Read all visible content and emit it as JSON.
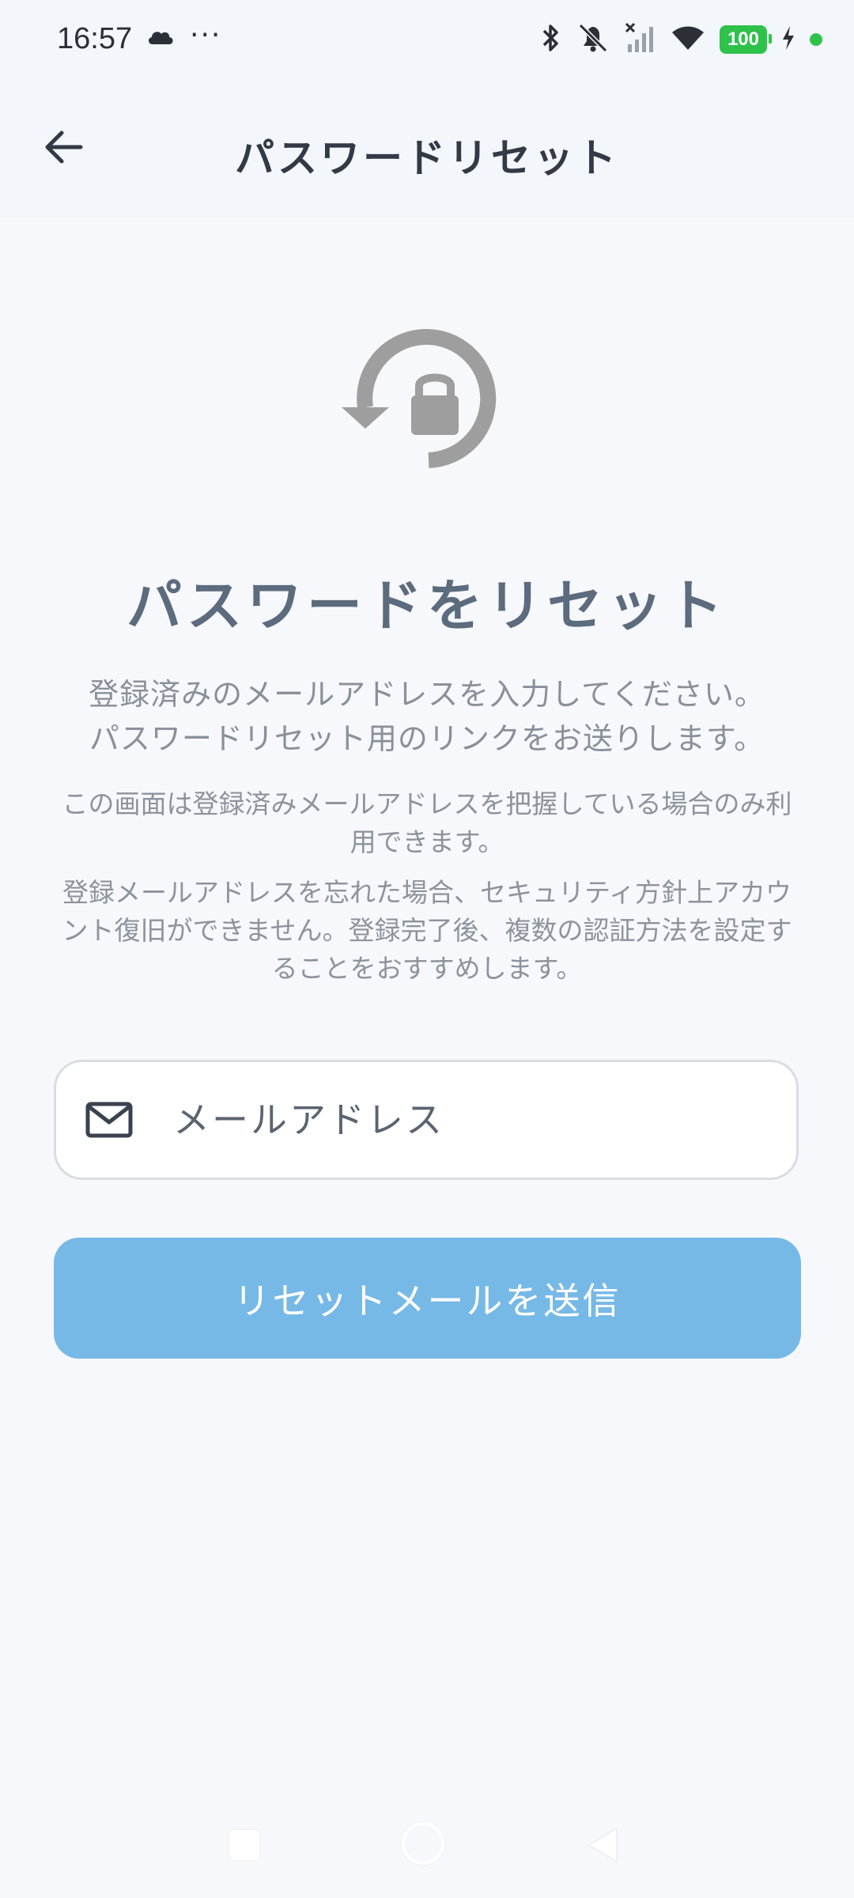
{
  "status_bar": {
    "time": "16:57",
    "dots": "···",
    "battery": "100",
    "icons": [
      "cloud-icon",
      "bluetooth-icon",
      "bell-off-icon",
      "signal-off-icon",
      "wifi-icon",
      "charging-icon"
    ]
  },
  "app_bar": {
    "title": "パスワードリセット",
    "back_icon": "arrow-left-icon"
  },
  "main": {
    "hero_icon": "lock-reset-icon",
    "headline": "パスワードをリセット",
    "description_line1": "登録済みのメールアドレスを入力してください。",
    "description_line2": "パスワードリセット用のリンクをお送りします。",
    "note1": "この画面は登録済みメールアドレスを把握している場合のみ利用できます。",
    "note2": "登録メールアドレスを忘れた場合、セキュリティ方針上アカウント復旧ができません。登録完了後、複数の認証方法を設定することをおすすめします。",
    "email_placeholder": "メールアドレス",
    "submit_label": "リセットメールを送信"
  },
  "colors": {
    "background": "#f6f8fb",
    "headline": "#5c6b7d",
    "button": "#77b9e6",
    "battery": "#2ec24a"
  }
}
